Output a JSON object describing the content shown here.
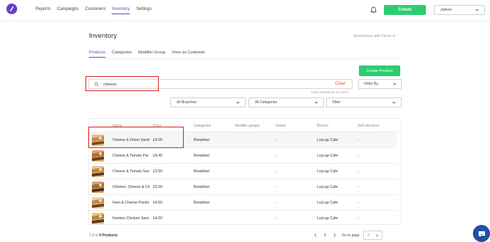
{
  "header": {
    "nav": [
      "Reports",
      "Campaigns",
      "Customers",
      "Inventory",
      "Settings"
    ],
    "active_nav": "Inventory",
    "create_label": "Create",
    "user": "James"
  },
  "page": {
    "title": "Inventory",
    "sync_label": "Synchronise with Clover",
    "tabs": [
      "Products",
      "Categories",
      "Modifier Group",
      "View as Customer"
    ],
    "active_tab": "Products",
    "create_product_label": "Create Product"
  },
  "search": {
    "value": "cheese",
    "clear_label": "Clear",
    "hint": "Press enter/return to search"
  },
  "order_by": "Order By",
  "filters": {
    "branches": "All Branches",
    "categories": "All Categories",
    "filter": "Filter"
  },
  "table": {
    "columns": [
      "Name",
      "Price",
      "Categories",
      "Modifier groups",
      "Online",
      "Branch",
      "Self checkout"
    ],
    "rows": [
      {
        "name": "Cheese & Onion Sand",
        "price": "£4.00",
        "category": "Breakfast",
        "modifier": "",
        "online": "-",
        "branch": "LoyLap Cafe",
        "self_checkout": "-"
      },
      {
        "name": "Cheese & Tomato Par",
        "price": "£4.40",
        "category": "Breakfast",
        "modifier": "",
        "online": "-",
        "branch": "LoyLap Cafe",
        "self_checkout": "-"
      },
      {
        "name": "Cheese & Tomato San",
        "price": "£3.50",
        "category": "Breakfast",
        "modifier": "",
        "online": "-",
        "branch": "LoyLap Cafe",
        "self_checkout": "-"
      },
      {
        "name": "Chicken, Cheese & Ch",
        "price": "£5.50",
        "category": "Breakfast",
        "modifier": "",
        "online": "-",
        "branch": "LoyLap Cafe",
        "self_checkout": "-"
      },
      {
        "name": "Ham & Cheese Panini",
        "price": "£4.50",
        "category": "Breakfast",
        "modifier": "",
        "online": "-",
        "branch": "LoyLap Cafe",
        "self_checkout": "-"
      },
      {
        "name": "Hunters Chicken Sanc",
        "price": "£4.00",
        "category": "",
        "modifier": "",
        "online": "-",
        "branch": "LoyLap Cafe",
        "self_checkout": "-"
      }
    ]
  },
  "pagination": {
    "count_prefix": "1-9 of",
    "count_bold": "9 Products",
    "page": "1",
    "goto_label": "Go to page",
    "goto_value": "0"
  },
  "colors": {
    "accent": "#6a3fc7",
    "green": "#2ecc71",
    "highlight": "#d81e1e",
    "chat": "#1f4fa3"
  }
}
